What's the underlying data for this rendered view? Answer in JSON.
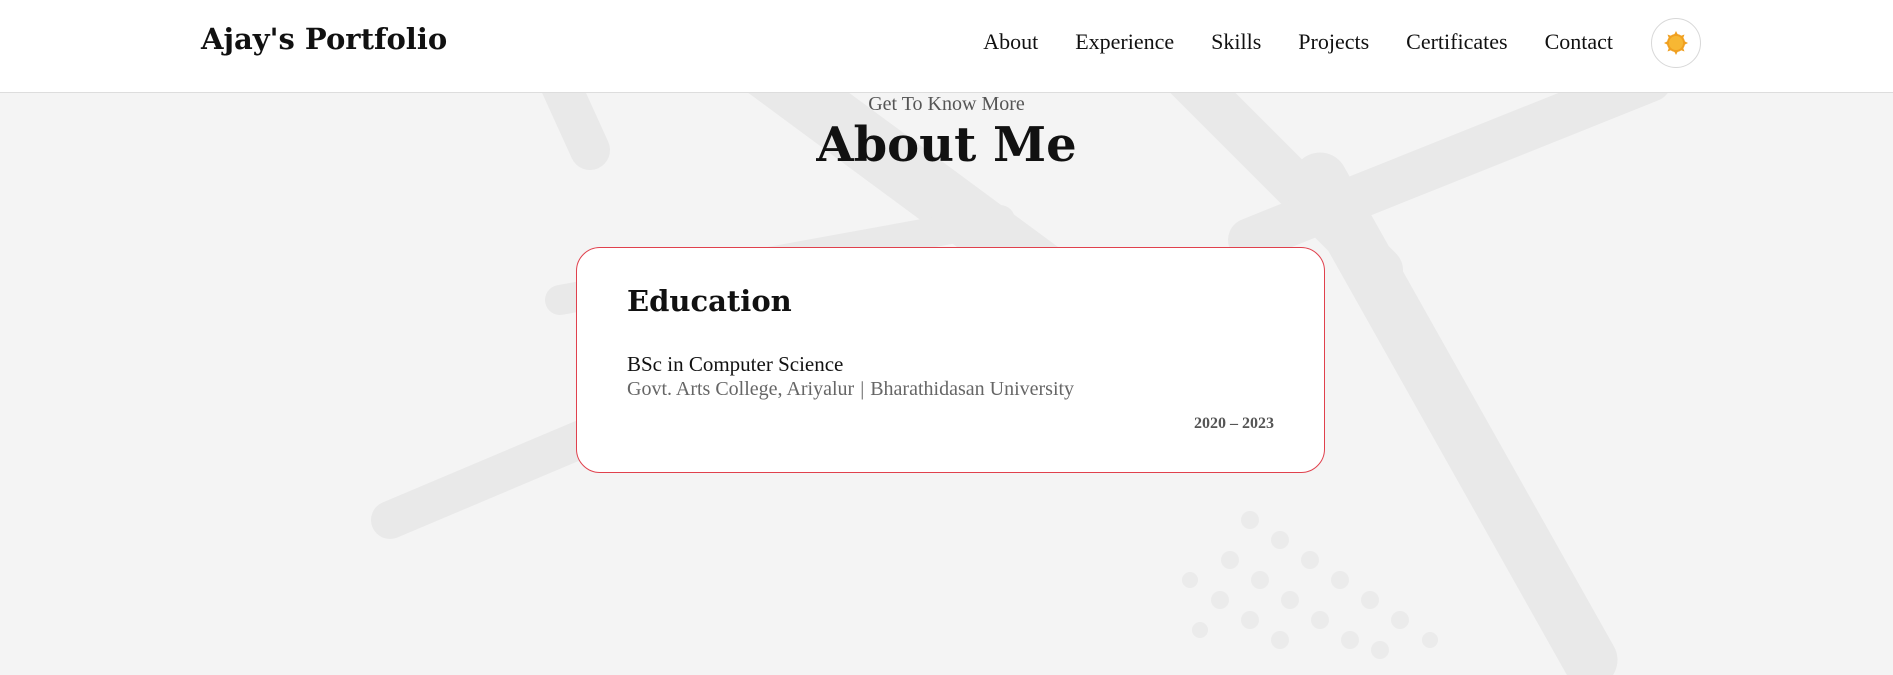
{
  "header": {
    "brand": "Ajay's Portfolio",
    "nav": [
      "About",
      "Experience",
      "Skills",
      "Projects",
      "Certificates",
      "Contact"
    ],
    "theme_toggle_icon": "sun-icon"
  },
  "section": {
    "subtitle": "Get To Know More",
    "title": "About Me"
  },
  "education": {
    "heading": "Education",
    "degree": "BSc in Computer Science",
    "college": "Govt. Arts College, Ariyalur",
    "separator": "|",
    "university": "Bharathidasan University",
    "years": "2020 – 2023"
  },
  "colors": {
    "card_border": "#e0414d",
    "background": "#f4f4f4",
    "sun": "#f5a623"
  }
}
